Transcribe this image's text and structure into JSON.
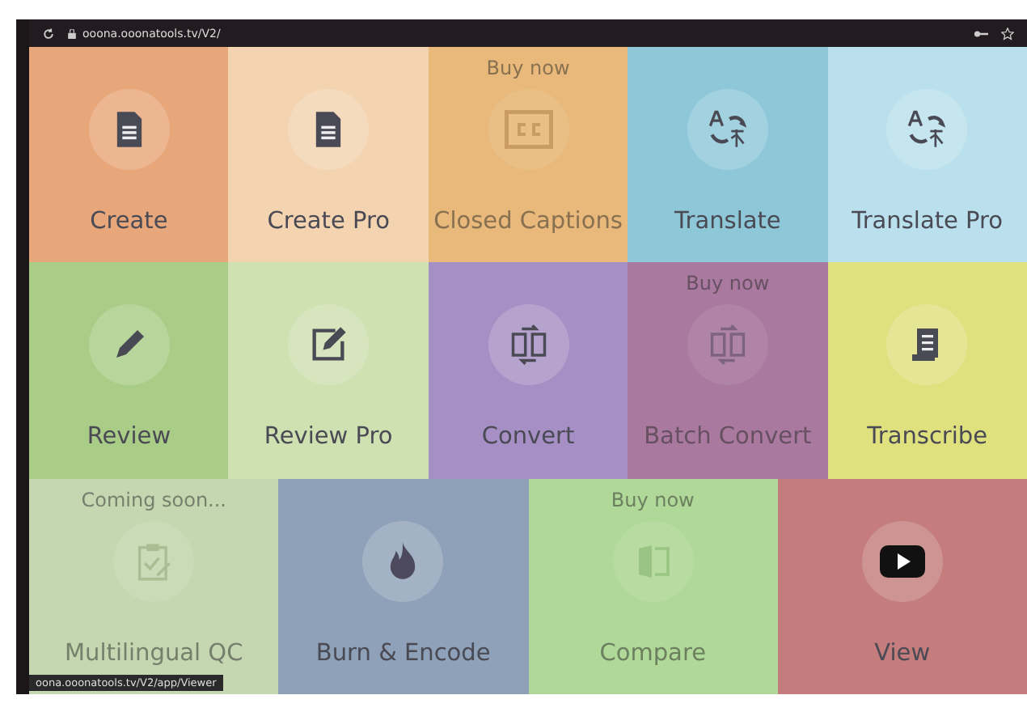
{
  "browser": {
    "address": "ooona.ooonatools.tv/V2/"
  },
  "rows": [
    [
      {
        "label": "Create",
        "kind": "document",
        "color": "#e8a77a",
        "disabled": false
      },
      {
        "label": "Create Pro",
        "kind": "document",
        "color": "#f3d3b0",
        "disabled": false
      },
      {
        "label": "Closed Captions",
        "kind": "cc",
        "color": "#e8b97a",
        "disabled": true,
        "note": "Buy now"
      },
      {
        "label": "Translate",
        "kind": "translate",
        "color": "#8ec8d8",
        "disabled": false
      },
      {
        "label": "Translate Pro",
        "kind": "translate",
        "color": "#b9e0ec",
        "disabled": false
      }
    ],
    [
      {
        "label": "Review",
        "kind": "pencil",
        "color": "#a9cd86",
        "disabled": false
      },
      {
        "label": "Review Pro",
        "kind": "edit",
        "color": "#cfe0b1",
        "disabled": false
      },
      {
        "label": "Convert",
        "kind": "convert",
        "color": "#a58fc4",
        "disabled": false
      },
      {
        "label": "Batch Convert",
        "kind": "convert",
        "color": "#a9799f",
        "disabled": true,
        "note": "Buy now"
      },
      {
        "label": "Transcribe",
        "kind": "scroll",
        "color": "#dfe17f",
        "disabled": false
      }
    ],
    [
      {
        "label": "Multilingual QC",
        "kind": "clipboard",
        "color": "#c4d7b0",
        "disabled": true,
        "note": "Coming soon..."
      },
      {
        "label": "Burn & Encode",
        "kind": "flame",
        "color": "#8fa1b8",
        "disabled": false
      },
      {
        "label": "Compare",
        "kind": "compare",
        "color": "#b0d898",
        "disabled": true,
        "note": "Buy now"
      },
      {
        "label": "View",
        "kind": "play",
        "color": "#c47d7c",
        "disabled": false
      }
    ]
  ],
  "status_bar": {
    "url": "oona.ooonatools.tv/V2/app/Viewer"
  }
}
